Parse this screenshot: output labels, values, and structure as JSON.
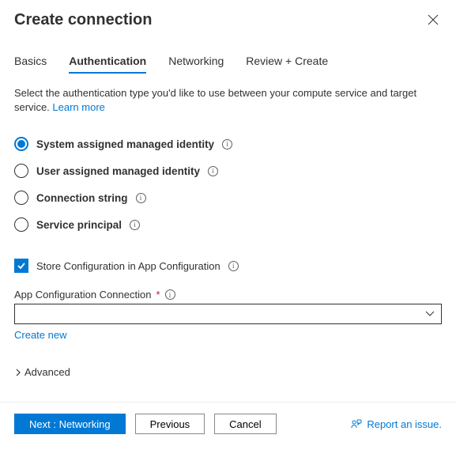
{
  "title": "Create connection",
  "tabs": [
    {
      "label": "Basics"
    },
    {
      "label": "Authentication"
    },
    {
      "label": "Networking"
    },
    {
      "label": "Review + Create"
    }
  ],
  "active_tab_index": 1,
  "description": "Select the authentication type you'd like to use between your compute service and target service. ",
  "learn_more": "Learn more",
  "auth_options": [
    {
      "label": "System assigned managed identity",
      "selected": true
    },
    {
      "label": "User assigned managed identity",
      "selected": false
    },
    {
      "label": "Connection string",
      "selected": false
    },
    {
      "label": "Service principal",
      "selected": false
    }
  ],
  "store_config_label": "Store Configuration in App Configuration",
  "store_config_checked": true,
  "app_config_label": "App Configuration Connection",
  "app_config_value": "",
  "create_new": "Create new",
  "advanced": "Advanced",
  "footer": {
    "next": "Next : Networking",
    "previous": "Previous",
    "cancel": "Cancel",
    "report": "Report an issue."
  }
}
